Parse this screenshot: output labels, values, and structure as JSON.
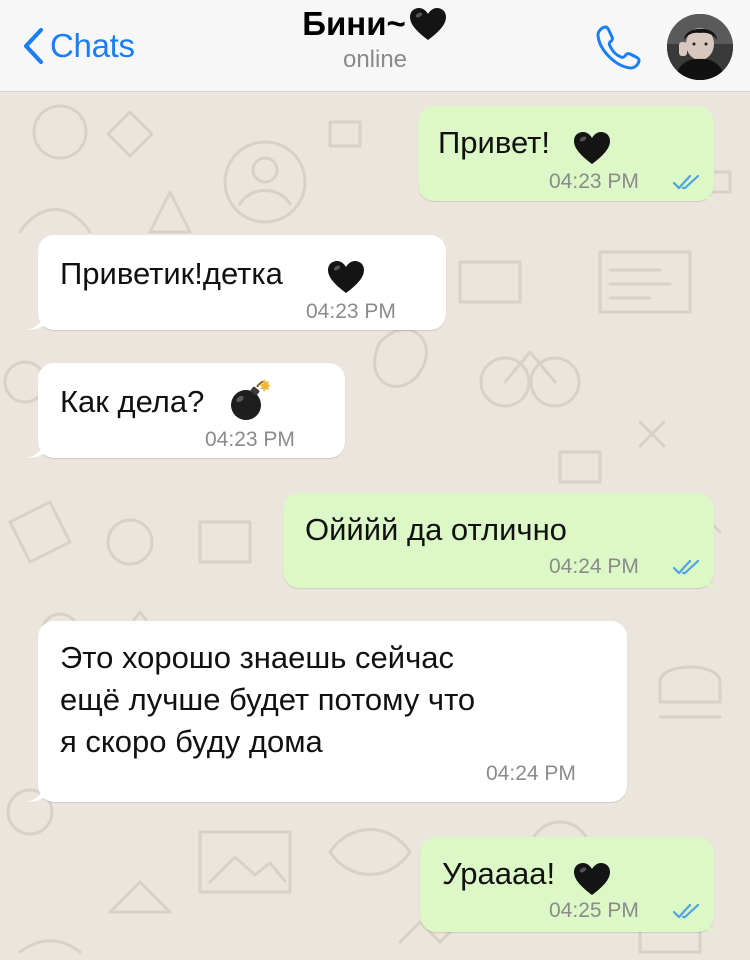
{
  "header": {
    "back_label": "Chats",
    "contact_name": "Бини~",
    "contact_emoji": "black-heart",
    "status": "online"
  },
  "colors": {
    "accent": "#1a7ef6",
    "outgoing_bubble": "#dcf8c6",
    "incoming_bubble": "#ffffff",
    "chat_background": "#ece5dd",
    "read_ticks": "#4fa3e0"
  },
  "messages": [
    {
      "direction": "out",
      "text": "Привет!",
      "emoji": "black-heart",
      "time": "04:23 PM",
      "status": "read"
    },
    {
      "direction": "in",
      "text": "Приветик!детка",
      "emoji": "black-heart",
      "time": "04:23 PM"
    },
    {
      "direction": "in",
      "text": "Как дела?",
      "emoji": "bomb",
      "time": "04:23 PM"
    },
    {
      "direction": "out",
      "text": "Ойййй да отлично",
      "time": "04:24 PM",
      "status": "read"
    },
    {
      "direction": "in",
      "lines": [
        "Это хорошо знаешь сейчас",
        "ещё лучше будет потому что",
        "я скоро буду дома"
      ],
      "time": "04:24 PM"
    },
    {
      "direction": "out",
      "text": "Ураааа!",
      "emoji": "black-heart",
      "time": "04:25 PM",
      "status": "read"
    }
  ]
}
